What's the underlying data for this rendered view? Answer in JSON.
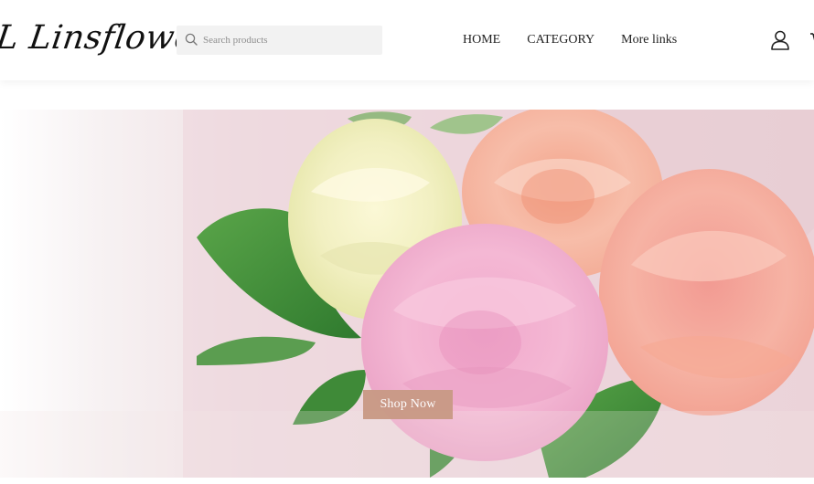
{
  "brand": {
    "logo_text": "L Linsflower"
  },
  "search": {
    "placeholder": "Search products",
    "icon": "search-icon"
  },
  "nav": {
    "items": [
      {
        "label": "HOME"
      },
      {
        "label": "CATEGORY"
      },
      {
        "label": "More links"
      }
    ]
  },
  "header_icons": {
    "account": "user-icon",
    "cart": "cart-icon"
  },
  "hero": {
    "image": "pink-and-cream-roses-bouquet",
    "cta_label": "Shop Now"
  },
  "colors": {
    "cta_background": "#c99a86",
    "cta_text": "#ffffff",
    "search_background": "#f2f2f2",
    "hero_background": "#edd8dd"
  }
}
